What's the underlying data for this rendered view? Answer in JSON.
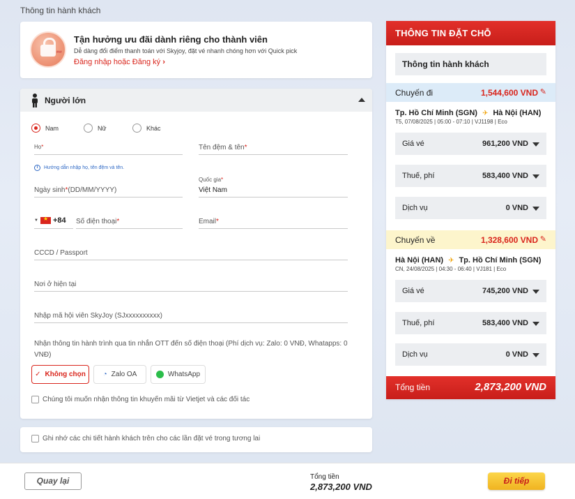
{
  "page": {
    "heading": "Thông tin hành khách"
  },
  "promo": {
    "title": "Tận hưởng ưu đãi dành riêng cho thành viên",
    "subtitle": "Dễ dàng đổi điểm thanh toán với Skyjoy, đặt vé nhanh chóng hơn với Quick pick",
    "link": "Đăng nhập hoặc Đăng ký",
    "badge_icon": "lock-badge-icon"
  },
  "form": {
    "section_title": "Người lớn",
    "gender": {
      "options": [
        "Nam",
        "Nữ",
        "Khác"
      ],
      "selected": "Nam"
    },
    "last_name_label": "Họ",
    "first_name_label": "Tên đệm & tên",
    "name_hint": "Hướng dẫn nhập họ, tên đệm và tên.",
    "dob_label": "Ngày sinh",
    "dob_format": "(DD/MM/YYYY)",
    "country_label": "Quốc gia",
    "country_value": "Việt Nam",
    "phone_code": "+84",
    "phone_label": "Số điện thoại",
    "email_label": "Email",
    "id_label": "CCCD / Passport",
    "address_label": "Nơi ở hiện tại",
    "skyjoy_label": "Nhập mã hội viên SkyJoy (SJxxxxxxxxxx)",
    "ott_text": "Nhận thông tin hành trình qua tin nhắn OTT đến số điện thoại (Phí dịch vụ: Zalo: 0 VNĐ, Whatapps: 0 VNĐ)",
    "ott_options": [
      "Không chọn",
      "Zalo OA",
      "WhatsApp"
    ],
    "ott_selected": "Không chọn",
    "promo_consent": "Chúng tôi muốn nhận thông tin khuyến mãi từ Vietjet và các đối tác",
    "remember": "Ghi nhớ các chi tiết hành khách trên cho các lần đặt vé trong tương lai"
  },
  "summary": {
    "title": "THÔNG TIN ĐẶT CHỖ",
    "pax_info": "Thông tin hành khách",
    "outbound": {
      "label": "Chuyến đi",
      "price": "1,544,600 VND",
      "from": "Tp. Hồ Chí Minh (SGN)",
      "to": "Hà Nội (HAN)",
      "details": "T5, 07/08/2025 | 05:00 - 07:10 | VJ1198 | Eco",
      "fare_label": "Giá vé",
      "fare": "961,200 VND",
      "tax_label": "Thuế, phí",
      "tax": "583,400 VND",
      "service_label": "Dịch vụ",
      "service": "0 VND",
      "bar_color": "#dcebf8"
    },
    "return": {
      "label": "Chuyến về",
      "price": "1,328,600 VND",
      "from": "Hà Nội (HAN)",
      "to": "Tp. Hồ Chí Minh (SGN)",
      "details": "CN, 24/08/2025 | 04:30 - 06:40 | VJ181 | Eco",
      "fare_label": "Giá vé",
      "fare": "745,200 VND",
      "tax_label": "Thuế, phí",
      "tax": "583,400 VND",
      "service_label": "Dịch vụ",
      "service": "0 VND",
      "bar_color": "#fdf5cc"
    },
    "total_label": "Tổng tiền",
    "total": "2,873,200 VND"
  },
  "footer": {
    "back": "Quay lại",
    "total_label": "Tổng tiền",
    "total": "2,873,200 VND",
    "next": "Đi tiếp"
  },
  "colors": {
    "brand_red": "#d9251c",
    "cta_yellow": "#f0b320"
  }
}
